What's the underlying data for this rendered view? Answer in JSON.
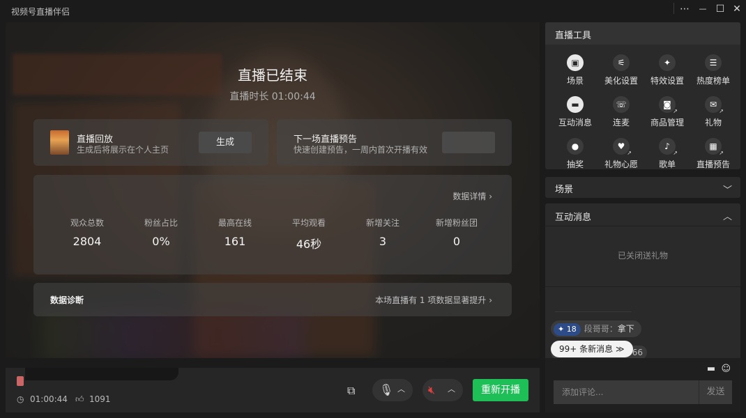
{
  "window": {
    "title": "视频号直播伴侣",
    "controls": {
      "more": "⋯",
      "minimize": "—",
      "maximize": "☐",
      "close": "✕"
    }
  },
  "stage": {
    "end_title": "直播已结束",
    "duration_text": "直播时长 01:00:44",
    "replay": {
      "title": "直播回放",
      "subtitle": "生成后将展示在个人主页",
      "button": "生成"
    },
    "preview": {
      "title": "下一场直播预告",
      "subtitle": "快速创建预告，一周内首次开播有效"
    },
    "stats_link": "数据详情 ›",
    "stats": [
      {
        "label": "观众总数",
        "value": "2804"
      },
      {
        "label": "粉丝占比",
        "value": "0%"
      },
      {
        "label": "最高在线",
        "value": "161"
      },
      {
        "label": "平均观看",
        "value": "46秒"
      },
      {
        "label": "新增关注",
        "value": "3"
      },
      {
        "label": "新增粉丝团",
        "value": "0"
      }
    ],
    "diagnosis": {
      "title": "数据诊断",
      "link": "本场直播有 1 项数据显著提升 ›"
    }
  },
  "bottom": {
    "duration": "01:00:44",
    "likes": "1091",
    "restart_button": "重新开播",
    "icons": [
      "clock-icon",
      "thumbs-up-icon",
      "share-screen-icon",
      "microphone-icon",
      "speaker-muted-icon"
    ]
  },
  "tools": {
    "heading": "直播工具",
    "items": [
      {
        "label": "场景",
        "icon": "scene-icon",
        "glyph": "▣",
        "fill": true
      },
      {
        "label": "美化设置",
        "icon": "sliders-icon",
        "glyph": "⚟"
      },
      {
        "label": "特效设置",
        "icon": "sparkle-icon",
        "glyph": "✦"
      },
      {
        "label": "热度榜单",
        "icon": "list-icon",
        "glyph": "☰"
      },
      {
        "label": "互动消息",
        "icon": "message-icon",
        "glyph": "▬",
        "fill": true
      },
      {
        "label": "连麦",
        "icon": "phone-icon",
        "glyph": "☏"
      },
      {
        "label": "商品管理",
        "icon": "shopping-bag-icon",
        "glyph": "◙",
        "badge": "↗"
      },
      {
        "label": "礼物",
        "icon": "gift-icon",
        "glyph": "✉",
        "badge": "↗"
      },
      {
        "label": "抽奖",
        "icon": "lottery-bag-icon",
        "glyph": "●"
      },
      {
        "label": "礼物心愿",
        "icon": "heart-icon",
        "glyph": "♥",
        "badge": "↗"
      },
      {
        "label": "歌单",
        "icon": "music-icon",
        "glyph": "♪",
        "badge": "↗"
      },
      {
        "label": "直播预告",
        "icon": "calendar-icon",
        "glyph": "▦",
        "badge": "↗"
      }
    ]
  },
  "scene_panel": {
    "heading": "场景",
    "chevron": "﹀"
  },
  "interact_panel": {
    "heading": "互动消息",
    "chevron": "︿",
    "gift_status": "已关闭送礼物",
    "message": {
      "level": "18",
      "name": "段哥哥：",
      "text": "拿下"
    },
    "partial_count": "366",
    "new_messages": "99+ 条新消息 ≫",
    "comment_placeholder": "添加评论...",
    "send_button": "发送"
  },
  "colors": {
    "accent_green": "#1fbf58",
    "level_badge": "#2d4b86",
    "panel": "#2a2a2a",
    "background": "#1b1b1b"
  }
}
